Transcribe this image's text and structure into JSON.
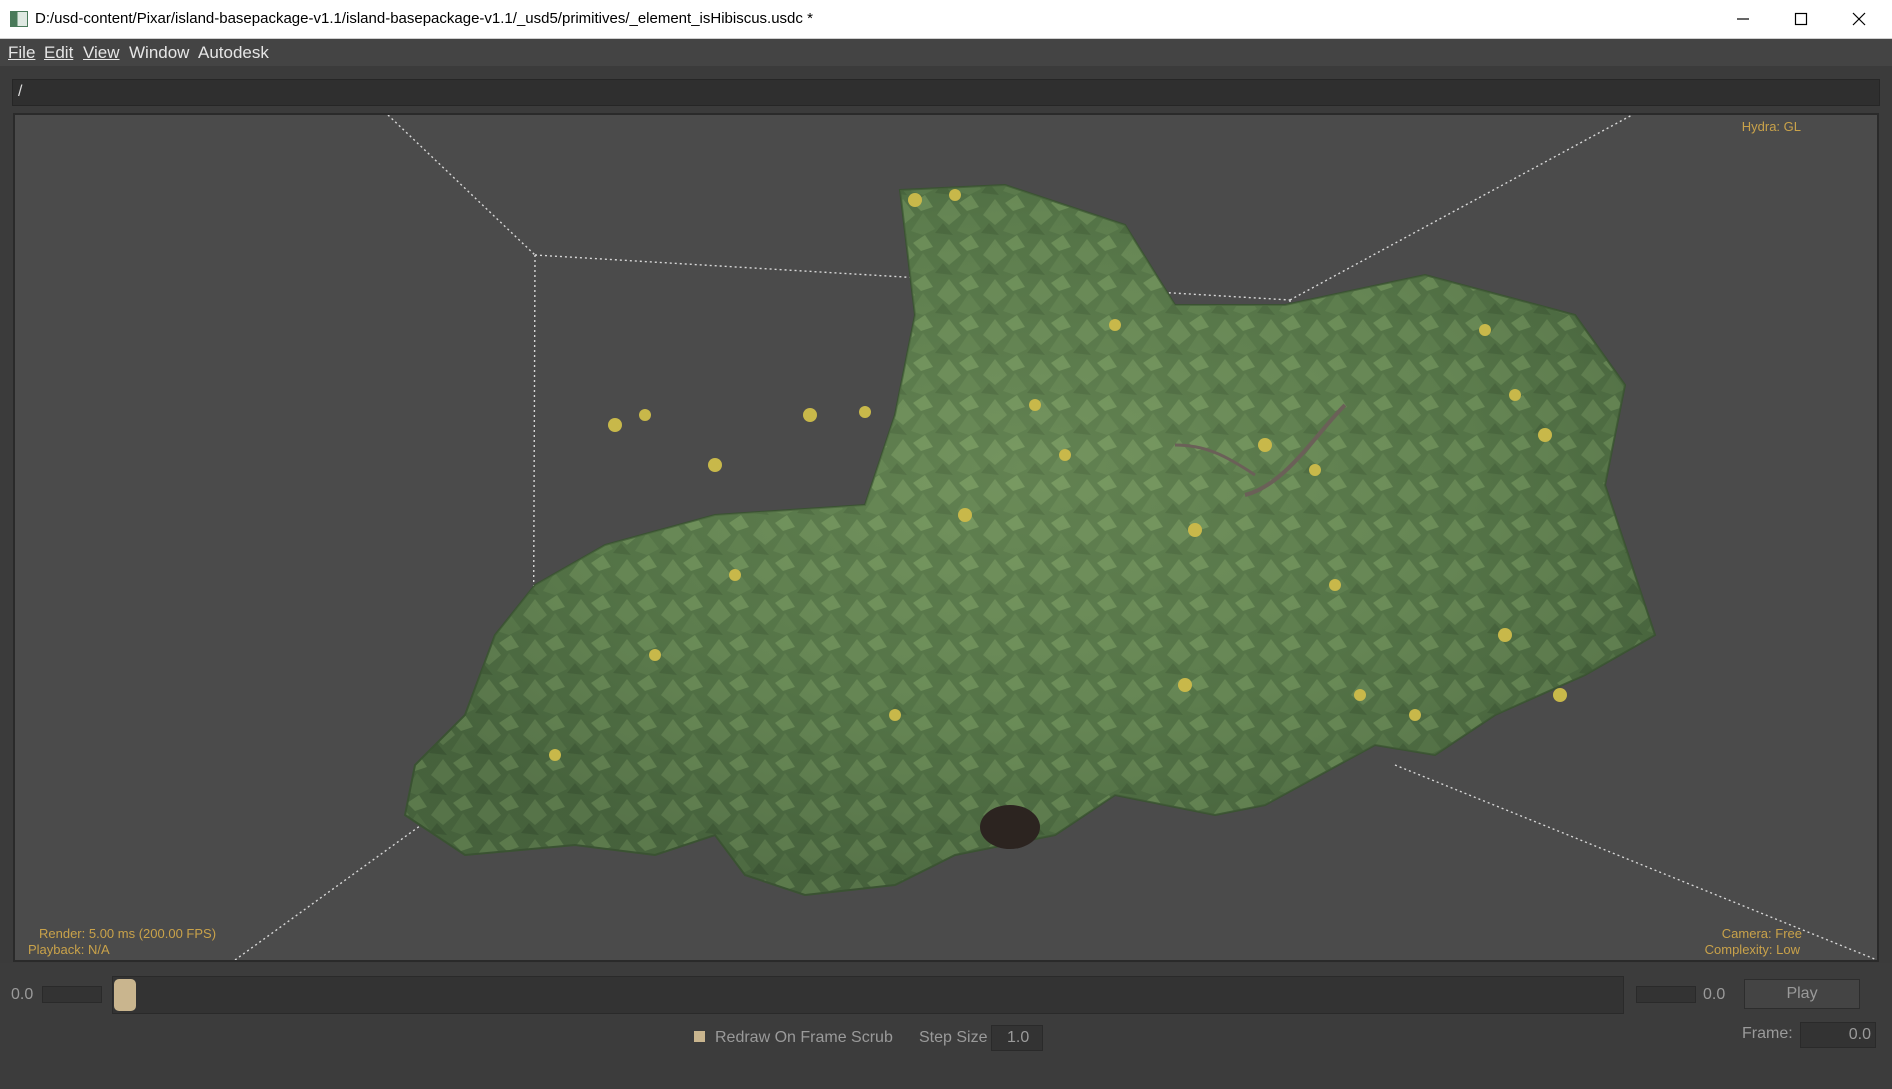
{
  "window": {
    "title": "D:/usd-content/Pixar/island-basepackage-v1.1/island-basepackage-v1.1/_usd5/primitives/_element_isHibiscus.usdc *",
    "controls": [
      "minimize-icon",
      "maximize-icon",
      "close-icon"
    ]
  },
  "menu": {
    "file": "File",
    "edit": "Edit",
    "view": "View",
    "window": "Window",
    "autodesk": "Autodesk"
  },
  "path_bar": {
    "value": "/"
  },
  "viewport": {
    "renderer": "Hydra: GL",
    "render_stats": "Render: 5.00 ms (200.00 FPS)",
    "playback": "Playback: N/A",
    "camera": "Camera: Free",
    "complexity": "Complexity: Low",
    "colors": {
      "hud": "#c9a24a",
      "background": "#4b4b4b",
      "foliage": "#5c7f4e",
      "flower": "#c8b84a"
    }
  },
  "timeline": {
    "start_value": "0.0",
    "end_value": "0.0",
    "play_label": "Play",
    "redraw_label": "Redraw On Frame Scrub",
    "redraw_checked": true,
    "step_size_label": "Step Size",
    "step_size_value": "1.0",
    "frame_label": "Frame:",
    "frame_value": "0.0"
  }
}
